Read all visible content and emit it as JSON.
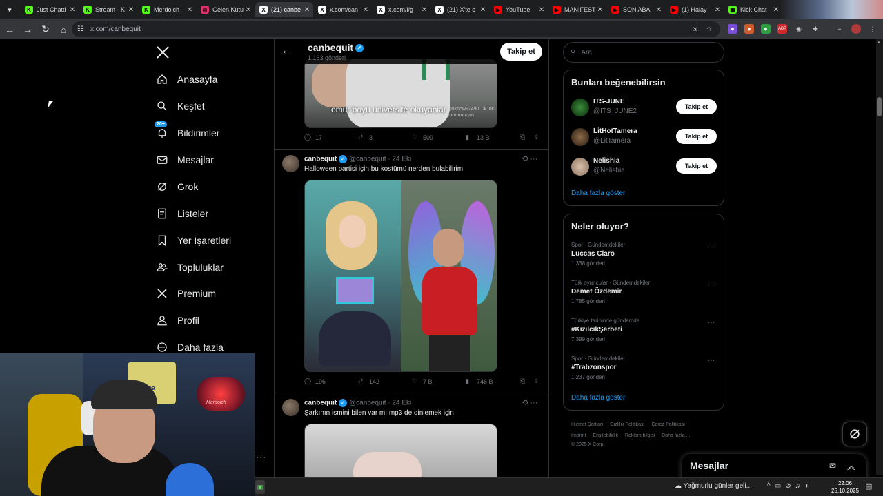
{
  "browser": {
    "tabs": [
      {
        "title": "Just Chatti",
        "fav": "K",
        "color": "#53fc18",
        "active": false
      },
      {
        "title": "Stream - K",
        "fav": "K",
        "color": "#53fc18",
        "active": false
      },
      {
        "title": "Merdoich",
        "fav": "K",
        "color": "#53fc18",
        "active": false
      },
      {
        "title": "Gelen Kutu",
        "fav": "◎",
        "color": "#e1306c",
        "active": false
      },
      {
        "title": "(21) canbe",
        "fav": "X",
        "color": "#ffffff",
        "active": true
      },
      {
        "title": "x.com/can",
        "fav": "X",
        "color": "#ffffff",
        "active": false
      },
      {
        "title": "x.com/i/g",
        "fav": "X",
        "color": "#ffffff",
        "active": false
      },
      {
        "title": "(21) X'te c",
        "fav": "X",
        "color": "#ffffff",
        "active": false
      },
      {
        "title": "YouTube",
        "fav": "▶",
        "color": "#ff0000",
        "active": false
      },
      {
        "title": "MANIFEST",
        "fav": "▶",
        "color": "#ff0000",
        "active": false
      },
      {
        "title": "SON ABA",
        "fav": "▶",
        "color": "#ff0000",
        "active": false
      },
      {
        "title": "(1) Halay",
        "fav": "▶",
        "color": "#ff0000",
        "active": false
      },
      {
        "title": "Kick Chat",
        "fav": "▦",
        "color": "#53fc18",
        "active": false
      }
    ],
    "url": "x.com/canbequit"
  },
  "nav": {
    "items": [
      {
        "label": "Anasayfa",
        "icon": "home-icon"
      },
      {
        "label": "Keşfet",
        "icon": "search-icon"
      },
      {
        "label": "Bildirimler",
        "icon": "bell-icon",
        "badge": "20+"
      },
      {
        "label": "Mesajlar",
        "icon": "mail-icon"
      },
      {
        "label": "Grok",
        "icon": "grok-icon"
      },
      {
        "label": "Listeler",
        "icon": "list-icon"
      },
      {
        "label": "Yer İşaretleri",
        "icon": "bookmark-icon"
      },
      {
        "label": "Topluluklar",
        "icon": "communities-icon"
      },
      {
        "label": "Premium",
        "icon": "x-premium-icon"
      },
      {
        "label": "Profil",
        "icon": "profile-icon"
      },
      {
        "label": "Daha fazla",
        "icon": "more-icon"
      }
    ]
  },
  "webcam": {
    "jersey_text": "avea",
    "sign_text": "Merdoich"
  },
  "profile": {
    "name": "canbequit",
    "post_count": "1.163 gönderi",
    "follow_label": "Takip et"
  },
  "tweet1": {
    "caption": "omur boyu universite okuyanlar",
    "watermark": "@tiknow92490 TikTok yorumundan",
    "replies": "17",
    "reposts": "3",
    "likes": "509",
    "views": "13 B"
  },
  "tweet2": {
    "name": "canbequit",
    "handle": "@canbequit",
    "date": "· 24 Eki",
    "text": "Halloween partisi için bu kostümü nerden bulabilirim",
    "replies": "196",
    "reposts": "142",
    "likes": "7 B",
    "views": "746 B"
  },
  "tweet3": {
    "name": "canbequit",
    "handle": "@canbequit",
    "date": "· 24 Eki",
    "text": "Şarkının ismini bilen var mı mp3 de dinlemek için"
  },
  "search": {
    "placeholder": "Ara"
  },
  "suggestions": {
    "title": "Bunları beğenebilirsin",
    "items": [
      {
        "name": "ITS-JUNE",
        "handle": "@ITS_JUNE2",
        "button": "Takip et"
      },
      {
        "name": "LitHotTamera",
        "handle": "@LitTamera",
        "button": "Takip et"
      },
      {
        "name": "Nelishia",
        "handle": "@Nelishia",
        "button": "Takip et"
      }
    ],
    "more": "Daha fazla göster"
  },
  "trends": {
    "title": "Neler oluyor?",
    "items": [
      {
        "context": "Spor · Gündemdekiler",
        "topic": "Luccas Claro",
        "count": "1.338 gönderi"
      },
      {
        "context": "Türk oyuncular · Gündemdekiler",
        "topic": "Demet Özdemir",
        "count": "1.785 gönderi"
      },
      {
        "context": "Türkiye tarihinde gündemde",
        "topic": "#KızılcıkŞerbeti",
        "count": "7.399 gönderi"
      },
      {
        "context": "Spor · Gündemdekiler",
        "topic": "#Trabzonspor",
        "count": "1.237 gönderi"
      }
    ],
    "more": "Daha fazla göster"
  },
  "footer": {
    "links": [
      "Hizmet Şartları",
      "Gizlilik Politikası",
      "Çerez Politikası",
      "Imprint",
      "Erişilebilirlik",
      "Reklam bilgisi",
      "Daha fazla ..."
    ],
    "copyright": "© 2025 X Corp."
  },
  "messages_dock": {
    "title": "Mesajlar"
  },
  "taskbar": {
    "weather": "Yağmurlu günler geli...",
    "time": "22:06",
    "date": "25.10.2025"
  }
}
